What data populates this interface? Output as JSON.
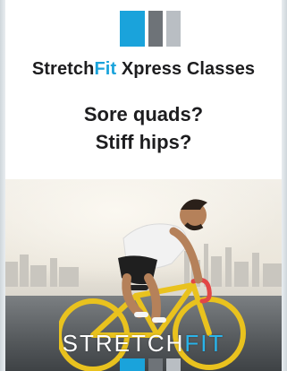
{
  "ad": {
    "headline_part1": "Stretch",
    "headline_part2": "Fit",
    "headline_part3": " Xpress Classes",
    "question1": "Sore quads?",
    "question2": "Stiff hips?",
    "logo_part1": "STRETCH",
    "logo_part2": "FIT"
  },
  "colors": {
    "accent": "#1aa3db",
    "text": "#1d1d1f",
    "gray_block": "#6e7378",
    "light_block": "#b9bec3"
  },
  "icons": {
    "brand_mark": "stretchfit-brand-blocks"
  }
}
